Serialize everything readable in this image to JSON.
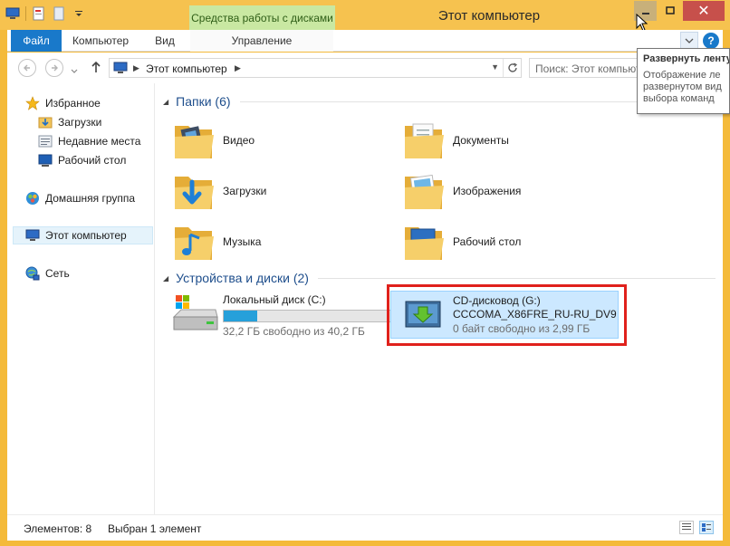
{
  "window": {
    "title": "Этот компьютер",
    "context_tab": "Средства работы с дисками",
    "close_glyph": "✕"
  },
  "ribbon": {
    "tabs": [
      {
        "label": "Файл"
      },
      {
        "label": "Компьютер"
      },
      {
        "label": "Вид"
      },
      {
        "label": "Управление"
      }
    ],
    "help_glyph": "?"
  },
  "address": {
    "path": "Этот компьютер",
    "search_placeholder": "Поиск: Этот компьютер"
  },
  "navigation": {
    "items": [
      {
        "label": "Избранное",
        "icon": "star-icon"
      },
      {
        "label": "Загрузки",
        "icon": "downloads-icon"
      },
      {
        "label": "Недавние места",
        "icon": "recent-places-icon"
      },
      {
        "label": "Рабочий стол",
        "icon": "desktop-icon"
      },
      {
        "label": "Домашняя группа",
        "icon": "homegroup-icon"
      },
      {
        "label": "Этот компьютер",
        "icon": "computer-icon",
        "selected": true
      },
      {
        "label": "Сеть",
        "icon": "network-icon"
      }
    ]
  },
  "folders": {
    "group_title": "Папки (6)",
    "items": [
      {
        "label": "Видео",
        "icon": "video-folder-icon"
      },
      {
        "label": "Документы",
        "icon": "documents-folder-icon"
      },
      {
        "label": "Загрузки",
        "icon": "downloads-folder-icon"
      },
      {
        "label": "Изображения",
        "icon": "pictures-folder-icon"
      },
      {
        "label": "Музыка",
        "icon": "music-folder-icon"
      },
      {
        "label": "Рабочий стол",
        "icon": "desktop-folder-icon"
      }
    ]
  },
  "devices": {
    "group_title": "Устройства и диски (2)",
    "local_disk": {
      "name": "Локальный диск (C:)",
      "free": "32,2 ГБ свободно из 40,2 ГБ",
      "used_fraction": 0.2
    },
    "cd_drive": {
      "name": "CD-дисковод (G:)",
      "label": "CCCOMA_X86FRE_RU-RU_DV9",
      "free": "0 байт свободно из 2,99 ГБ",
      "selected": true
    }
  },
  "status": {
    "items_count": "Элементов: 8",
    "selected": "Выбран 1 элемент"
  },
  "tooltip": {
    "title": "Развернуть ленту",
    "line1": "Отображение ле",
    "line2": "развернутом вид",
    "line3": "выбора команд"
  },
  "colors": {
    "frame": "#f4ba3a",
    "accent": "#1979ca",
    "context_tab": "#c9e8a2",
    "highlight": "#e0211c",
    "selection": "#cce8ff"
  }
}
